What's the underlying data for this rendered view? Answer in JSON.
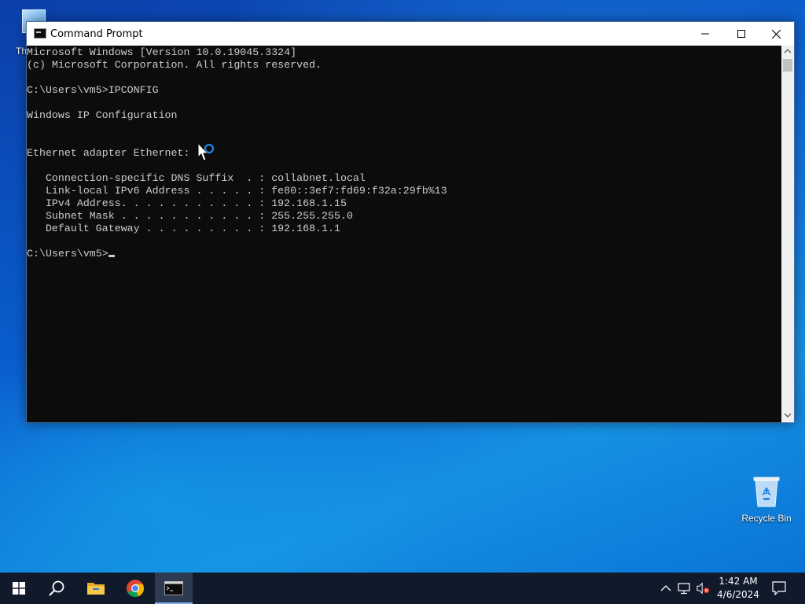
{
  "desktop": {
    "partial_icon_label": "Th",
    "recycle_bin_label": "Recycle Bin"
  },
  "window": {
    "title": "Command Prompt",
    "console_lines": [
      "Microsoft Windows [Version 10.0.19045.3324]",
      "(c) Microsoft Corporation. All rights reserved.",
      "",
      "C:\\Users\\vm5>IPCONFIG",
      "",
      "Windows IP Configuration",
      "",
      "",
      "Ethernet adapter Ethernet:",
      "",
      "   Connection-specific DNS Suffix  . : collabnet.local",
      "   Link-local IPv6 Address . . . . . : fe80::3ef7:fd69:f32a:29fb%13",
      "   IPv4 Address. . . . . . . . . . . : 192.168.1.15",
      "   Subnet Mask . . . . . . . . . . . : 255.255.255.0",
      "   Default Gateway . . . . . . . . . : 192.168.1.1",
      ""
    ],
    "prompt": "C:\\Users\\vm5>"
  },
  "taskbar": {
    "items": [
      "start-icon",
      "search-icon",
      "file-explorer-icon",
      "chrome-icon",
      "command-prompt-icon"
    ],
    "clock_time": "1:42 AM",
    "clock_date": "4/6/2024"
  },
  "colors": {
    "console_bg": "#0c0c0c",
    "console_text": "#cccccc",
    "taskbar_bg": "#101a2b",
    "desktop_accent": "#0a5fd0"
  }
}
